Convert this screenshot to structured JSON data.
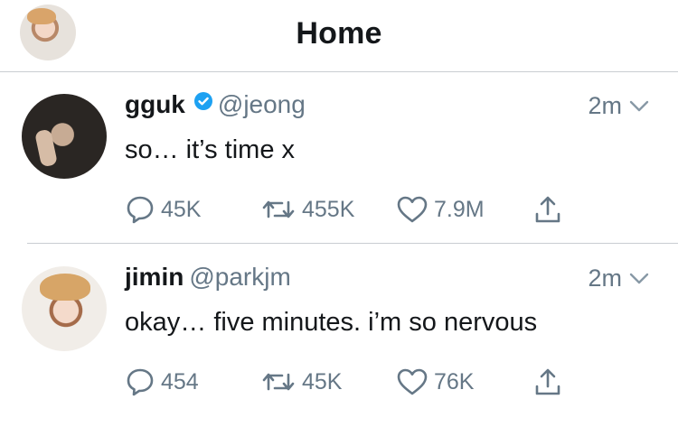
{
  "header": {
    "title": "Home"
  },
  "tweets": [
    {
      "name": "gguk",
      "verified": true,
      "handle": "@jeong",
      "time": "2m",
      "text": "so… it’s time x",
      "replies": "45K",
      "retweets": "455K",
      "likes": "7.9M"
    },
    {
      "name": "jimin",
      "verified": false,
      "handle": "@parkjm",
      "time": "2m",
      "text": "okay… five minutes. i’m so nervous",
      "replies": "454",
      "retweets": "45K",
      "likes": "76K"
    }
  ],
  "colors": {
    "text": "#14171a",
    "secondary": "#657786",
    "verified": "#1da1f2",
    "divider": "#c9cdd1"
  },
  "icons": [
    "reply-icon",
    "retweet-icon",
    "like-icon",
    "share-icon",
    "verified-badge-icon",
    "chevron-down-icon"
  ]
}
